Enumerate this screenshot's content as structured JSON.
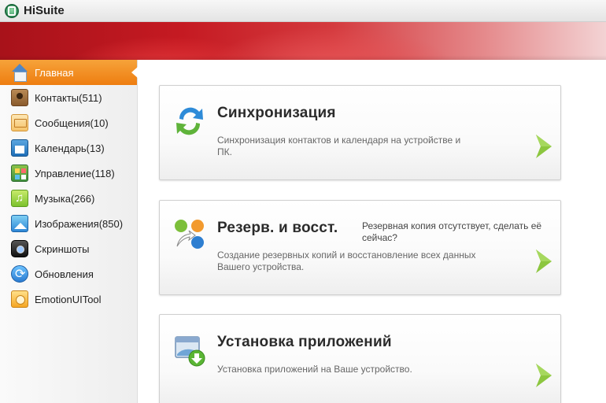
{
  "window": {
    "title": "HiSuite"
  },
  "sidebar": {
    "items": [
      {
        "label": "Главная",
        "icon": "home-icon"
      },
      {
        "label": "Контакты(511)",
        "icon": "contacts-icon"
      },
      {
        "label": "Сообщения(10)",
        "icon": "messages-icon"
      },
      {
        "label": "Календарь(13)",
        "icon": "calendar-icon"
      },
      {
        "label": "Управление(118)",
        "icon": "apps-management-icon"
      },
      {
        "label": "Музыка(266)",
        "icon": "music-icon"
      },
      {
        "label": "Изображения(850)",
        "icon": "images-icon"
      },
      {
        "label": "Скриншоты",
        "icon": "screenshots-icon"
      },
      {
        "label": "Обновления",
        "icon": "updates-icon"
      },
      {
        "label": "EmotionUITool",
        "icon": "emotionui-tool-icon"
      }
    ],
    "active_index": 0
  },
  "cards": {
    "sync": {
      "title": "Синхронизация",
      "description": "Синхронизация контактов и календаря на устройстве и ПК.",
      "icon": "sync-icon"
    },
    "backup": {
      "title": "Резерв. и восст.",
      "note": "Резервная копия отсутствует, сделать её сейчас?",
      "description": "Создание резервных копий и восстановление всех данных Вашего устройства.",
      "icon": "backup-restore-icon"
    },
    "install": {
      "title": "Установка приложений",
      "description": "Установка приложений на Ваше устройство.",
      "icon": "install-apps-icon"
    }
  },
  "colors": {
    "active_nav": "#ee7d10",
    "banner_red": "#c51a22",
    "arrow_green": "#8cc63f"
  }
}
